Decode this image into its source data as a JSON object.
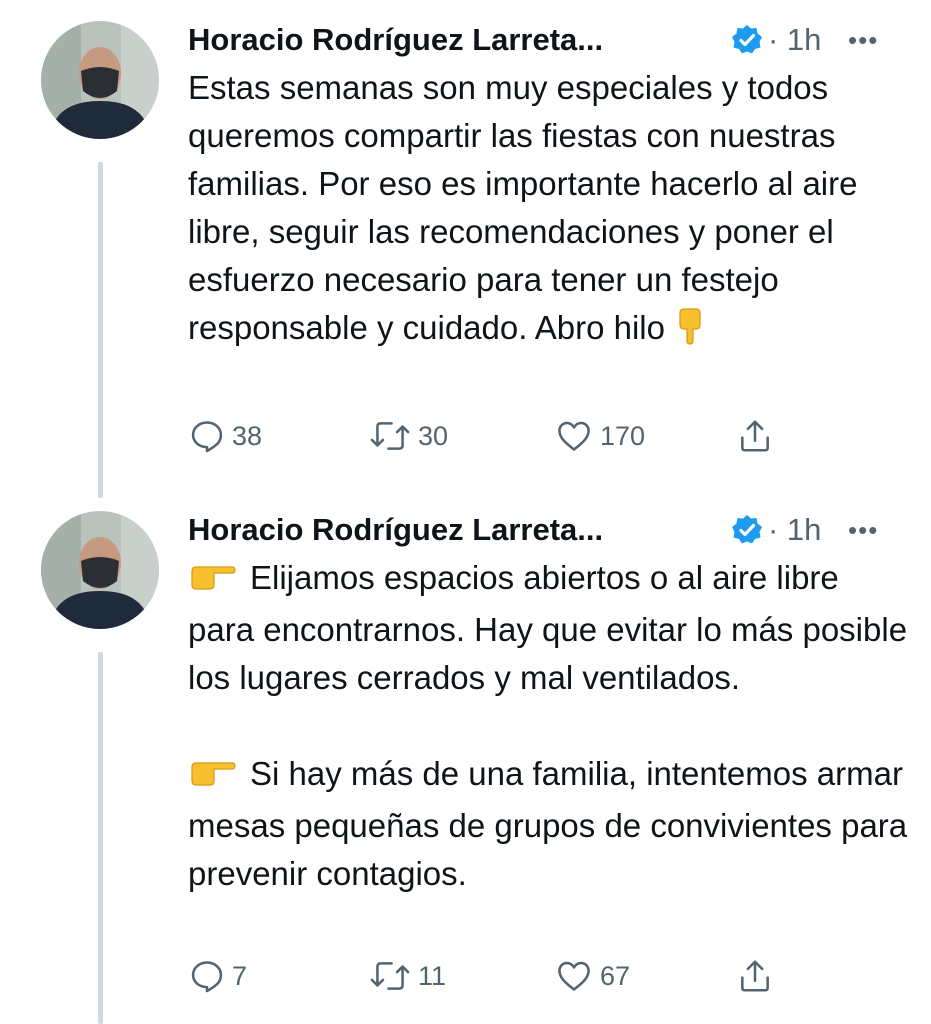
{
  "tweets": [
    {
      "author_name": "Horacio Rodríguez Larreta...",
      "time": "· 1h",
      "more": "•••",
      "text": "Estas semanas son muy especiales y todos queremos compartir las fiestas con nuestras familias. Por eso es importante hacerlo al aire libre, seguir las recomendaciones y poner el esfuerzo necesario para tener un festejo responsable y cuidado. Abro hilo",
      "replies": "38",
      "retweets": "30",
      "likes": "170"
    },
    {
      "author_name": "Horacio Rodríguez Larreta...",
      "time": "· 1h",
      "more": "•••",
      "paragraph_1": "Elijamos espacios abiertos o al aire libre para encontrarnos. Hay que evitar lo más posible los lugares cerrados y mal ventilados.",
      "paragraph_2": "Si hay más de una familia, intentemos armar mesas pequeñas de grupos de convivientes para prevenir contagios.",
      "replies": "7",
      "retweets": "11",
      "likes": "67"
    }
  ],
  "icons": {
    "verified": "verified-badge-icon",
    "reply": "reply-icon",
    "retweet": "retweet-icon",
    "like": "heart-icon",
    "share": "share-icon",
    "pointing_down": "backhand-index-pointing-down-emoji",
    "pointing_right": "backhand-index-pointing-right-emoji"
  },
  "colors": {
    "text": "#0f1419",
    "secondary": "#536471",
    "verified": "#1d9bf0",
    "thread_line": "#cfd9de"
  }
}
